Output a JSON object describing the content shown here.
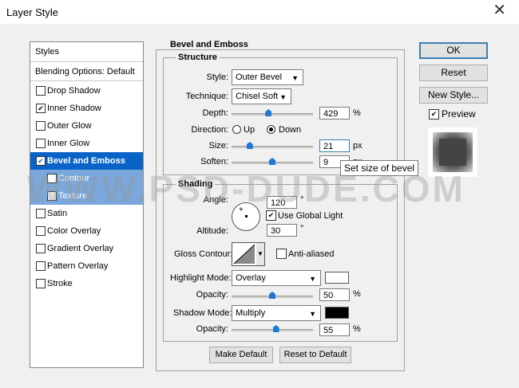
{
  "window": {
    "title": "Layer Style"
  },
  "styles_panel": {
    "header": "Styles",
    "blending": "Blending Options: Default",
    "items": [
      {
        "label": "Drop Shadow",
        "checked": false
      },
      {
        "label": "Inner Shadow",
        "checked": true
      },
      {
        "label": "Outer Glow",
        "checked": false
      },
      {
        "label": "Inner Glow",
        "checked": false
      },
      {
        "label": "Bevel and Emboss",
        "checked": true
      },
      {
        "label": "Contour",
        "checked": false
      },
      {
        "label": "Texture",
        "checked": false
      },
      {
        "label": "Satin",
        "checked": false
      },
      {
        "label": "Color Overlay",
        "checked": false
      },
      {
        "label": "Gradient Overlay",
        "checked": false
      },
      {
        "label": "Pattern Overlay",
        "checked": false
      },
      {
        "label": "Stroke",
        "checked": false
      }
    ]
  },
  "bevel": {
    "section_title": "Bevel and Emboss",
    "structure_title": "Structure",
    "style_label": "Style:",
    "style_value": "Outer Bevel",
    "technique_label": "Technique:",
    "technique_value": "Chisel Soft",
    "depth_label": "Depth:",
    "depth_value": "429",
    "depth_unit": "%",
    "depth_pos": 0.45,
    "direction_label": "Direction:",
    "dir_up": "Up",
    "dir_down": "Down",
    "direction_selected": "Down",
    "size_label": "Size:",
    "size_value": "21",
    "size_unit": "px",
    "size_pos": 0.2,
    "soften_label": "Soften:",
    "soften_value": "9",
    "soften_unit": "px",
    "soften_pos": 0.5
  },
  "shading": {
    "title": "Shading",
    "angle_label": "Angle:",
    "angle_value": "120",
    "angle_unit": "°",
    "global_light_label": "Use Global Light",
    "global_light": true,
    "altitude_label": "Altitude:",
    "altitude_value": "30",
    "altitude_unit": "°",
    "gloss_label": "Gloss Contour:",
    "anti_aliased_label": "Anti-aliased",
    "anti_aliased": false,
    "highlight_label": "Highlight Mode:",
    "highlight_value": "Overlay",
    "highlight_color": "#ffffff",
    "highlight_opacity_label": "Opacity:",
    "highlight_opacity": "50",
    "highlight_opacity_pos": 0.5,
    "shadow_label": "Shadow Mode:",
    "shadow_value": "Multiply",
    "shadow_color": "#000000",
    "shadow_opacity_label": "Opacity:",
    "shadow_opacity": "55",
    "shadow_opacity_pos": 0.55,
    "percent": "%"
  },
  "buttons": {
    "make_default": "Make Default",
    "reset_default": "Reset to Default",
    "ok": "OK",
    "reset": "Reset",
    "new_style": "New Style...",
    "preview": "Preview",
    "preview_checked": true
  },
  "tooltip": "Set size of bevel",
  "watermark": "WWW.PSD-DUDE.COM"
}
